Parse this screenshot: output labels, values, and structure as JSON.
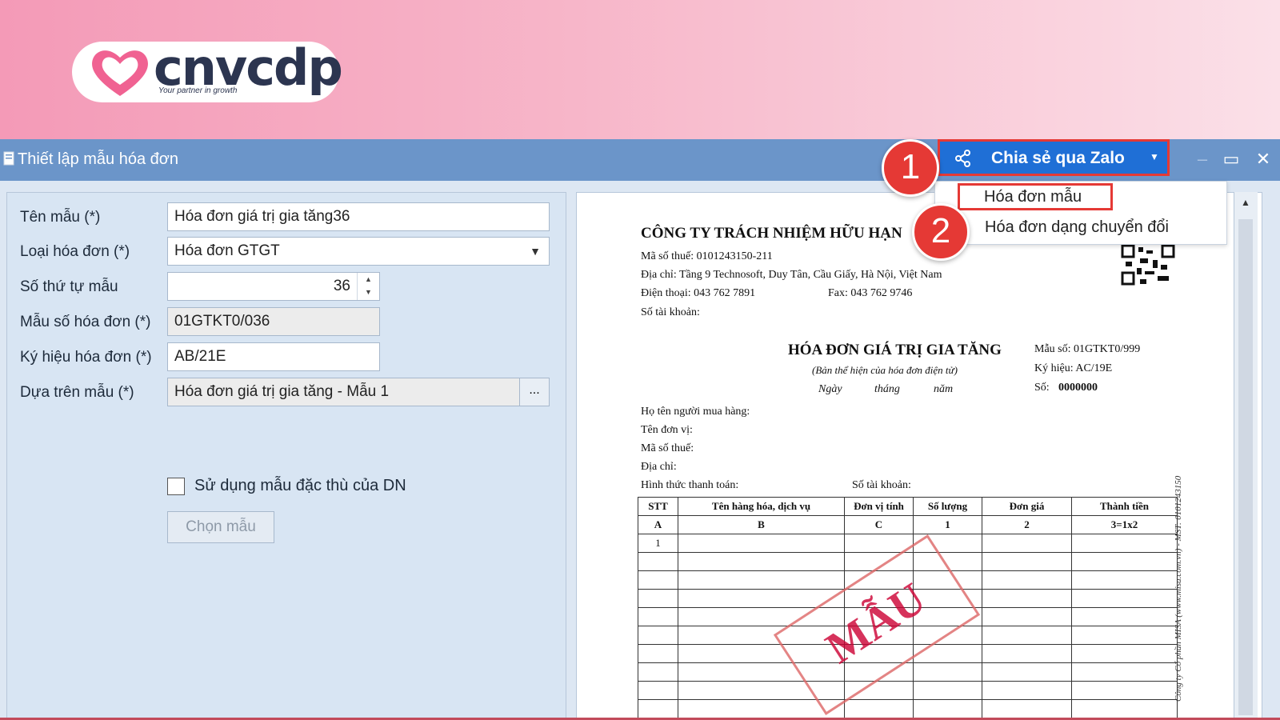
{
  "brand": {
    "logo_text": "cnvcdp",
    "tagline": "Your partner in growth"
  },
  "window": {
    "title": "Thiết lập mẫu hóa đơn"
  },
  "toolbar": {
    "share_label": "Chia sẻ qua Zalo"
  },
  "badges": {
    "one": "1",
    "two": "2"
  },
  "share_menu": {
    "items": [
      "Hóa đơn mẫu",
      "Hóa đơn dạng chuyển đổi"
    ]
  },
  "form": {
    "labels": {
      "name": "Tên mẫu (*)",
      "type": "Loại hóa đơn (*)",
      "order": "Số thứ tự mẫu",
      "template_code": "Mẫu số hóa đơn (*)",
      "symbol": "Ký hiệu hóa đơn (*)",
      "based_on": "Dựa trên mẫu (*)"
    },
    "values": {
      "name": "Hóa đơn giá trị gia tăng36",
      "type": "Hóa đơn GTGT",
      "order": "36",
      "template_code": "01GTKT0/036",
      "symbol": "AB/21E",
      "based_on": "Hóa đơn giá trị gia tăng - Mẫu 1"
    },
    "ellipsis": "...",
    "checkbox_label": "Sử dụng mẫu đặc thù của DN",
    "choose_button": "Chọn mẫu"
  },
  "preview": {
    "company": "CÔNG TY TRÁCH NHIỆM HỮU HẠN",
    "tax_code": "Mã số thuế:  0101243150-211",
    "address": "Địa chỉ:  Tầng 9 Technosoft, Duy Tân, Cầu Giấy, Hà Nội, Việt Nam",
    "phone": "Điện thoại:  043 762 7891",
    "fax": "Fax:  043 762 9746",
    "account": "Số tài khoản:",
    "title": "HÓA ĐƠN GIÁ TRỊ GIA TĂNG",
    "subtitle": "(Bản thể hiện của hóa đơn điện tử)",
    "date_day": "Ngày",
    "date_month": "tháng",
    "date_year": "năm",
    "form_no": "Mẫu số:  01GTKT0/999",
    "symbol": "Ký hiệu:  AC/19E",
    "number_label": "Số:",
    "number_value": "0000000",
    "buyer": "Họ tên người mua hàng:",
    "unit": "Tên đơn vị:",
    "buyer_tax": "Mã số thuế:",
    "buyer_address": "Địa chỉ:",
    "payment": "Hình thức thanh toán:",
    "buyer_account": "Số tài khoản:",
    "table": {
      "headers": [
        "STT",
        "Tên hàng hóa, dịch vụ",
        "Đơn vị tính",
        "Số lượng",
        "Đơn giá",
        "Thành tiền"
      ],
      "codes": [
        "A",
        "B",
        "C",
        "1",
        "2",
        "3=1x2"
      ],
      "first_row_index": "1"
    },
    "stamp": "MẪU",
    "side_note": "Công ty Cổ phần MISA (www.misa.com.vn) - MST: 0101243150"
  }
}
